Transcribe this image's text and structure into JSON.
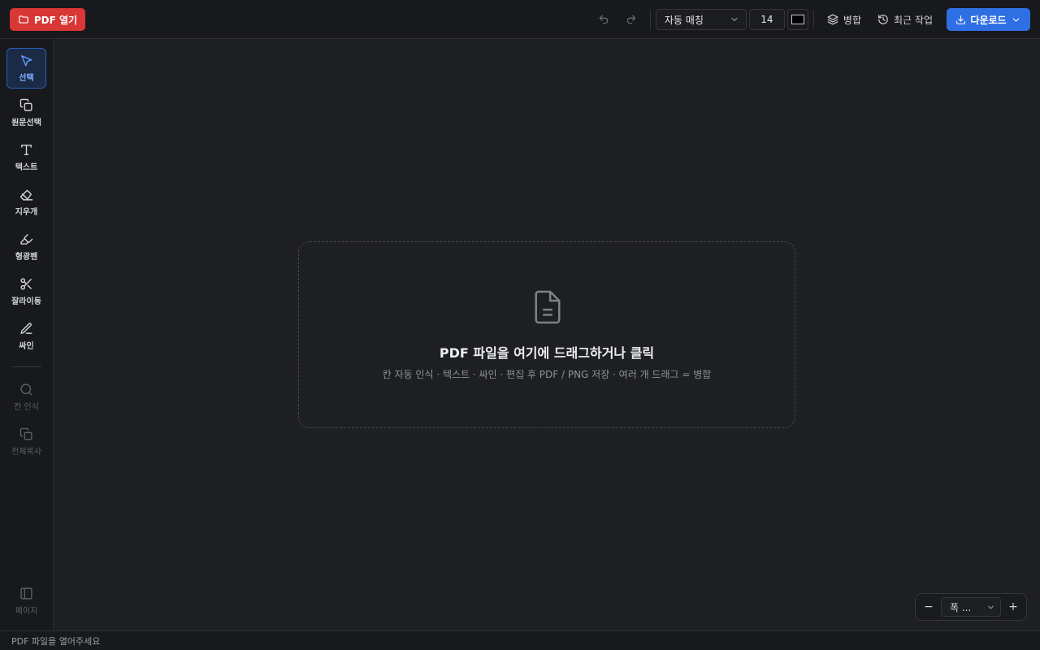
{
  "topbar": {
    "open_label": "PDF 열기",
    "font_select_value": "자동 매칭",
    "font_size_value": "14",
    "color_value": "#000000",
    "merge_label": "병합",
    "recent_label": "최근 작업",
    "download_label": "다운로드"
  },
  "sidebar": {
    "tools": [
      {
        "label": "선택",
        "icon": "cursor-icon"
      },
      {
        "label": "원문선택",
        "icon": "copy-icon"
      },
      {
        "label": "텍스트",
        "icon": "text-icon"
      },
      {
        "label": "지우개",
        "icon": "eraser-icon"
      },
      {
        "label": "형광펜",
        "icon": "highlighter-icon"
      },
      {
        "label": "잘라이동",
        "icon": "scissors-icon"
      },
      {
        "label": "싸인",
        "icon": "pen-icon"
      }
    ],
    "secondary": [
      {
        "label": "칸 인식",
        "icon": "search-icon"
      },
      {
        "label": "전체복사",
        "icon": "copy-icon"
      }
    ],
    "page_label": "페이지"
  },
  "dropzone": {
    "title": "PDF 파일을 여기에 드래그하거나 클릭",
    "subtitle": "칸 자동 인식 · 텍스트 · 싸인 · 편집 후 PDF / PNG 저장 · 여러 개 드래그 = 병합"
  },
  "zoom": {
    "minus": "−",
    "value": "폭 ...",
    "plus": "+"
  },
  "status": {
    "text": "PDF 파일을 열어주세요"
  },
  "colors": {
    "open_button": "#d93636",
    "download_button": "#2f6fe4",
    "active_tool": "#5f9bff"
  }
}
